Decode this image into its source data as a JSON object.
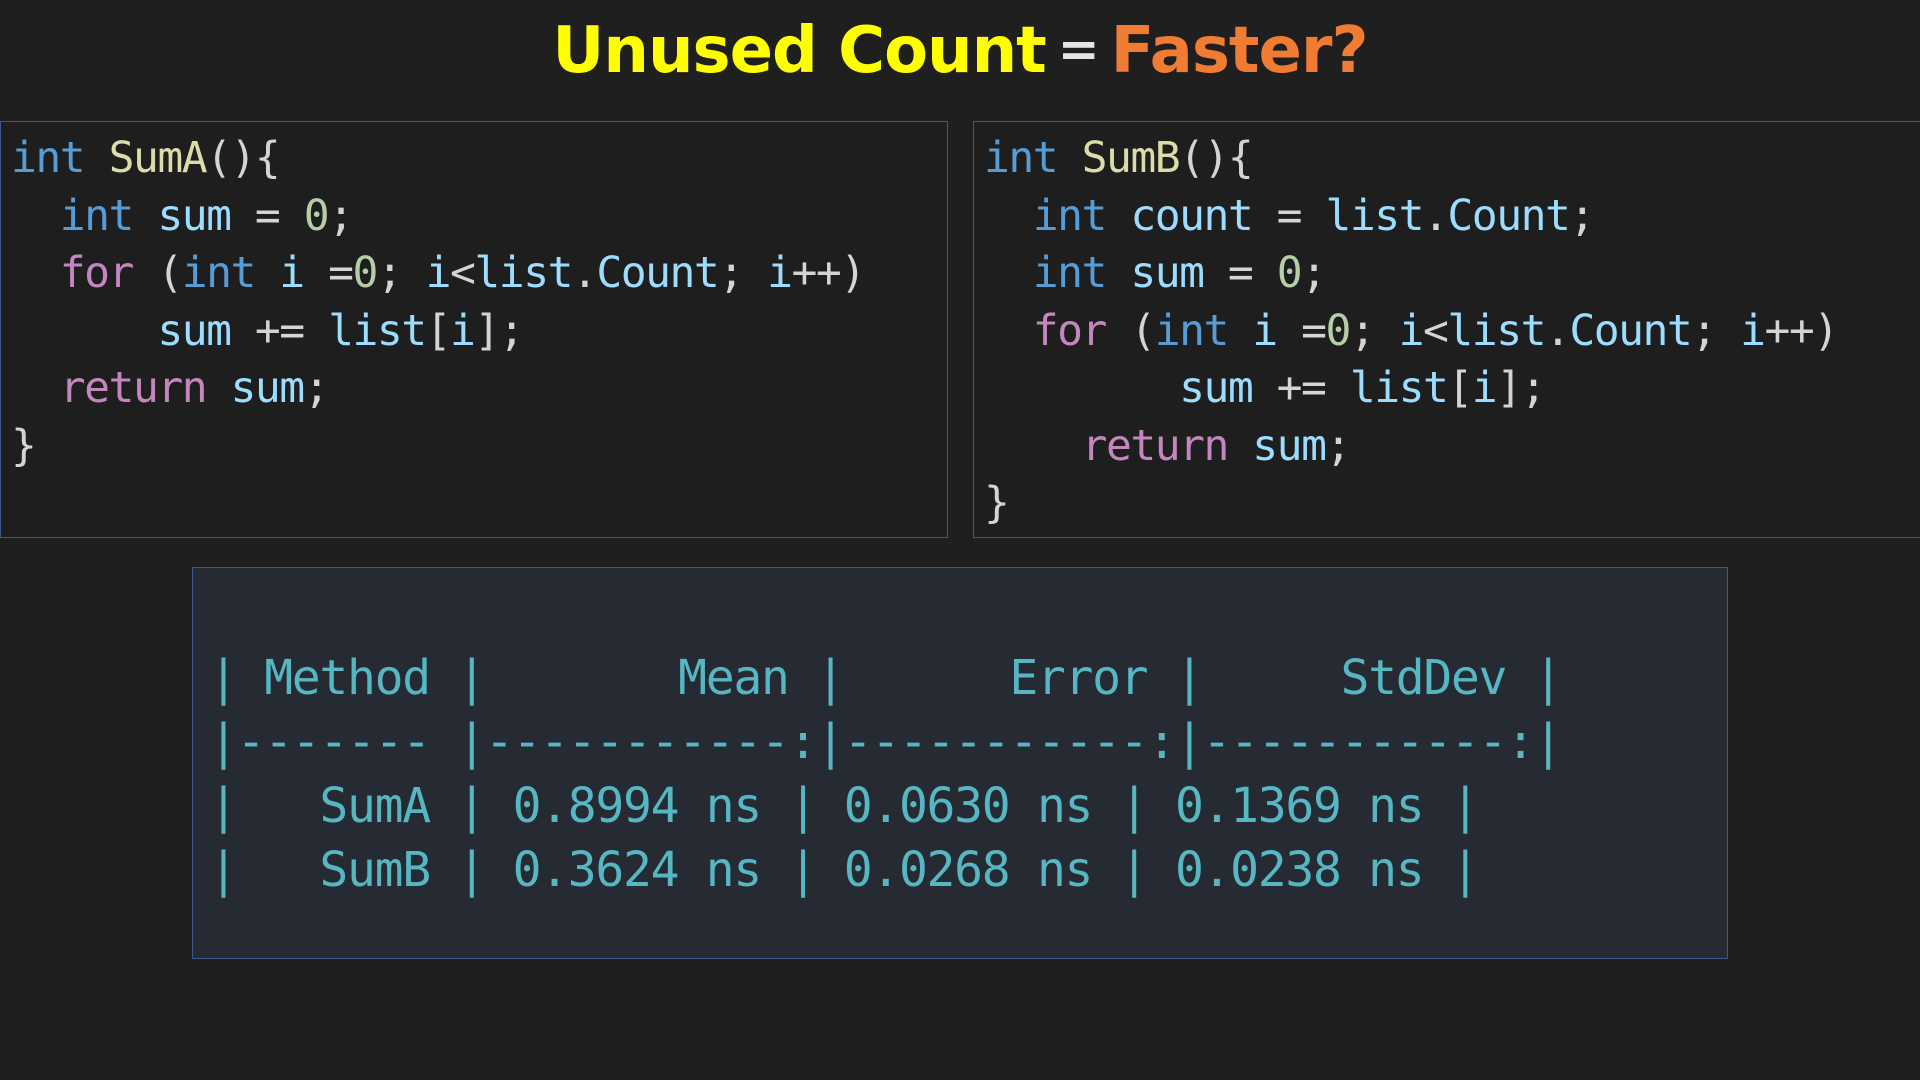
{
  "title": {
    "part1": "Unused Count",
    "equals": "=",
    "part2": "Faster?",
    "colors": {
      "part1": "#ffff00",
      "equals": "#e6e6e6",
      "part2": "#f07c33"
    }
  },
  "code_a": {
    "lines": [
      [
        {
          "t": "int",
          "c": "kw"
        },
        {
          "t": " "
        },
        {
          "t": "SumA",
          "c": "fn"
        },
        {
          "t": "(){",
          "c": "pun"
        }
      ],
      [
        {
          "t": "  "
        },
        {
          "t": "int",
          "c": "kw"
        },
        {
          "t": " "
        },
        {
          "t": "sum",
          "c": "var"
        },
        {
          "t": " = ",
          "c": "pun"
        },
        {
          "t": "0",
          "c": "num"
        },
        {
          "t": ";",
          "c": "pun"
        }
      ],
      [
        {
          "t": "  "
        },
        {
          "t": "for",
          "c": "ctl"
        },
        {
          "t": " (",
          "c": "pun"
        },
        {
          "t": "int",
          "c": "kw"
        },
        {
          "t": " "
        },
        {
          "t": "i",
          "c": "var"
        },
        {
          "t": " =",
          "c": "pun"
        },
        {
          "t": "0",
          "c": "num"
        },
        {
          "t": "; ",
          "c": "pun"
        },
        {
          "t": "i",
          "c": "var"
        },
        {
          "t": "<",
          "c": "pun"
        },
        {
          "t": "list",
          "c": "var"
        },
        {
          "t": ".",
          "c": "pun"
        },
        {
          "t": "Count",
          "c": "var"
        },
        {
          "t": "; ",
          "c": "pun"
        },
        {
          "t": "i",
          "c": "var"
        },
        {
          "t": "++)",
          "c": "pun"
        }
      ],
      [
        {
          "t": "      "
        },
        {
          "t": "sum",
          "c": "var"
        },
        {
          "t": " += ",
          "c": "pun"
        },
        {
          "t": "list",
          "c": "var"
        },
        {
          "t": "[",
          "c": "pun"
        },
        {
          "t": "i",
          "c": "var"
        },
        {
          "t": "];",
          "c": "pun"
        }
      ],
      [
        {
          "t": "  "
        },
        {
          "t": "return",
          "c": "ctl"
        },
        {
          "t": " "
        },
        {
          "t": "sum",
          "c": "var"
        },
        {
          "t": ";",
          "c": "pun"
        }
      ],
      [
        {
          "t": "}",
          "c": "pun"
        }
      ]
    ]
  },
  "code_b": {
    "lines": [
      [
        {
          "t": "int",
          "c": "kw"
        },
        {
          "t": " "
        },
        {
          "t": "SumB",
          "c": "fn"
        },
        {
          "t": "(){",
          "c": "pun"
        }
      ],
      [
        {
          "t": "  "
        },
        {
          "t": "int",
          "c": "kw"
        },
        {
          "t": " "
        },
        {
          "t": "count",
          "c": "var"
        },
        {
          "t": " = ",
          "c": "pun"
        },
        {
          "t": "list",
          "c": "var"
        },
        {
          "t": ".",
          "c": "pun"
        },
        {
          "t": "Count",
          "c": "var"
        },
        {
          "t": ";",
          "c": "pun"
        }
      ],
      [
        {
          "t": "  "
        },
        {
          "t": "int",
          "c": "kw"
        },
        {
          "t": " "
        },
        {
          "t": "sum",
          "c": "var"
        },
        {
          "t": " = ",
          "c": "pun"
        },
        {
          "t": "0",
          "c": "num"
        },
        {
          "t": ";",
          "c": "pun"
        }
      ],
      [
        {
          "t": "  "
        },
        {
          "t": "for",
          "c": "ctl"
        },
        {
          "t": " (",
          "c": "pun"
        },
        {
          "t": "int",
          "c": "kw"
        },
        {
          "t": " "
        },
        {
          "t": "i",
          "c": "var"
        },
        {
          "t": " =",
          "c": "pun"
        },
        {
          "t": "0",
          "c": "num"
        },
        {
          "t": "; ",
          "c": "pun"
        },
        {
          "t": "i",
          "c": "var"
        },
        {
          "t": "<",
          "c": "pun"
        },
        {
          "t": "list",
          "c": "var"
        },
        {
          "t": ".",
          "c": "pun"
        },
        {
          "t": "Count",
          "c": "var"
        },
        {
          "t": "; ",
          "c": "pun"
        },
        {
          "t": "i",
          "c": "var"
        },
        {
          "t": "++)",
          "c": "pun"
        }
      ],
      [
        {
          "t": "        "
        },
        {
          "t": "sum",
          "c": "var"
        },
        {
          "t": " += ",
          "c": "pun"
        },
        {
          "t": "list",
          "c": "var"
        },
        {
          "t": "[",
          "c": "pun"
        },
        {
          "t": "i",
          "c": "var"
        },
        {
          "t": "];",
          "c": "pun"
        }
      ],
      [
        {
          "t": "    "
        },
        {
          "t": "return",
          "c": "ctl"
        },
        {
          "t": " "
        },
        {
          "t": "sum",
          "c": "var"
        },
        {
          "t": ";",
          "c": "pun"
        }
      ],
      [
        {
          "t": "}",
          "c": "pun"
        }
      ]
    ]
  },
  "benchmark": {
    "columns": [
      "Method",
      "Mean",
      "Error",
      "StdDev"
    ],
    "rows": [
      [
        "SumA",
        "0.8994 ns",
        "0.0630 ns",
        "0.1369 ns"
      ],
      [
        "SumB",
        "0.3624 ns",
        "0.0268 ns",
        "0.0238 ns"
      ]
    ],
    "text": [
      "| Method |       Mean |      Error |     StdDev |",
      "|------- |-----------:|-----------:|-----------:|",
      "|   SumA | 0.8994 ns | 0.0630 ns | 0.1369 ns |",
      "|   SumB | 0.3624 ns | 0.0268 ns | 0.0238 ns |"
    ],
    "text_color": "#56b6c2"
  }
}
